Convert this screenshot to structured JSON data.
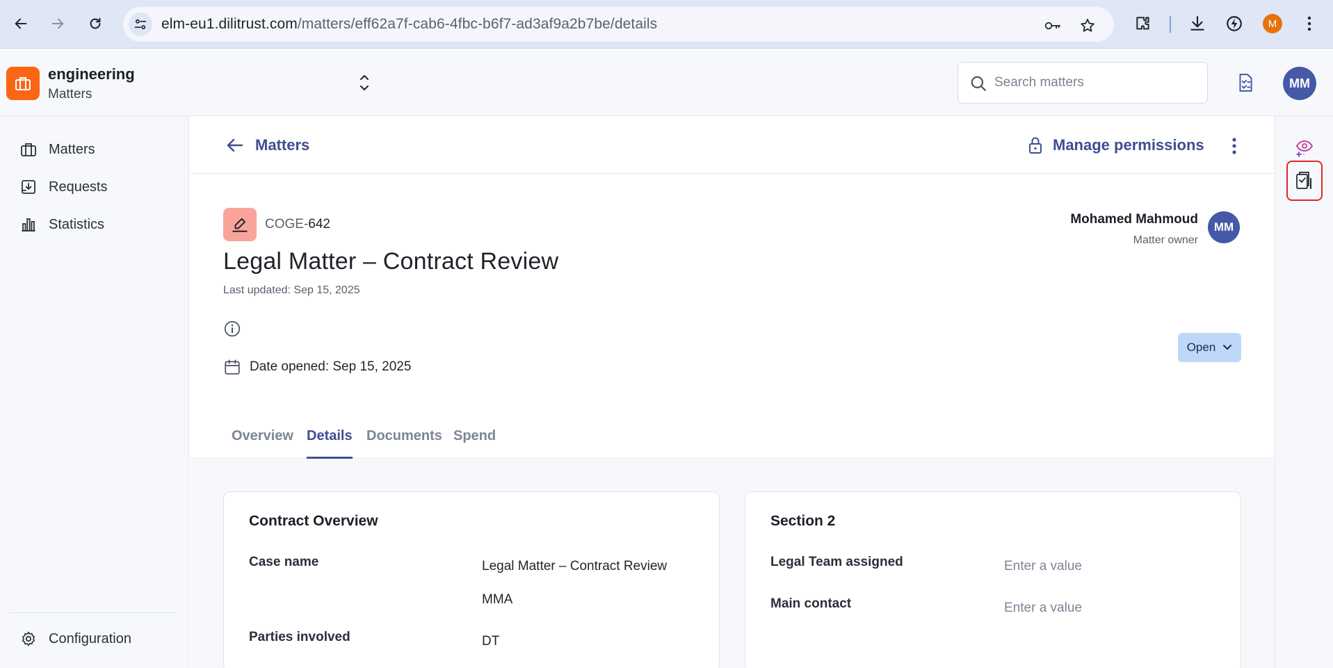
{
  "browser": {
    "url_host": "elm-eu1.dilitrust.com",
    "url_path": "/matters/eff62a7f-cab6-4fbc-b6f7-ad3af9a2b7be/details",
    "profile_initial": "M"
  },
  "header": {
    "workspace_name": "engineering",
    "workspace_section": "Matters",
    "search_placeholder": "Search matters",
    "avatar_initials": "MM"
  },
  "sidebar": {
    "items": [
      {
        "label": "Matters",
        "icon": "briefcase-icon"
      },
      {
        "label": "Requests",
        "icon": "inbox-download-icon"
      },
      {
        "label": "Statistics",
        "icon": "bar-chart-icon"
      }
    ],
    "footer": {
      "label": "Configuration",
      "icon": "gear-icon"
    }
  },
  "topbar": {
    "back_label": "Matters",
    "permissions_label": "Manage permissions"
  },
  "matter": {
    "code_prefix": "COGE-",
    "code_number": "642",
    "title": "Legal Matter – Contract Review",
    "last_updated": "Last updated: Sep 15, 2025",
    "date_opened": "Date opened: Sep 15, 2025",
    "owner_name": "Mohamed Mahmoud",
    "owner_role": "Matter owner",
    "owner_initials": "MM",
    "status": "Open"
  },
  "tabs": [
    {
      "label": "Overview",
      "active": false
    },
    {
      "label": "Details",
      "active": true
    },
    {
      "label": "Documents",
      "active": false
    },
    {
      "label": "Spend",
      "active": false
    }
  ],
  "cards": {
    "contract_overview": {
      "title": "Contract Overview",
      "case_name_label": "Case name",
      "case_name_value": "Legal Matter – Contract Review",
      "case_name_extra": "MMA",
      "parties_label": "Parties involved",
      "parties_value": "DT"
    },
    "section2": {
      "title": "Section 2",
      "legal_team_label": "Legal Team assigned",
      "legal_team_placeholder": "Enter a value",
      "main_contact_label": "Main contact",
      "main_contact_placeholder": "Enter a value"
    }
  },
  "colors": {
    "accent": "#3f4e92",
    "workspace_logo": "#fb6616",
    "avatar": "#4659a8",
    "matter_badge": "#f9a49b",
    "status_button": "#bfd8fa",
    "highlight_border": "#e0262b"
  }
}
